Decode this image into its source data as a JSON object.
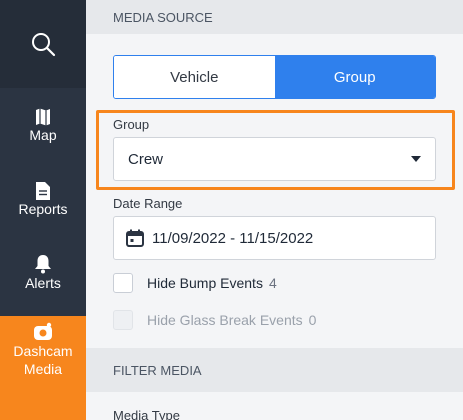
{
  "nav": {
    "search_icon": "search-icon",
    "items": [
      {
        "label": "Map",
        "icon": "map-icon"
      },
      {
        "label": "Reports",
        "icon": "file-icon"
      },
      {
        "label": "Alerts",
        "icon": "bell-icon"
      },
      {
        "label_line1": "Dashcam",
        "label_line2": "Media",
        "icon": "camera-icon",
        "active": true
      }
    ]
  },
  "media_source": {
    "header": "MEDIA SOURCE",
    "toggle": {
      "options": [
        "Vehicle",
        "Group"
      ],
      "selected": "Group"
    },
    "group_label": "Group",
    "group_value": "Crew",
    "date_label": "Date Range",
    "date_value": "11/09/2022 - 11/15/2022",
    "hide_bump": {
      "label": "Hide Bump Events",
      "count": "4"
    },
    "hide_glass": {
      "label": "Hide Glass Break Events",
      "count": "0"
    }
  },
  "filter_media": {
    "header": "FILTER MEDIA",
    "media_type_label": "Media Type"
  },
  "colors": {
    "rail": "#2b3442",
    "accent": "#f7861d",
    "primary": "#2f80ed"
  }
}
